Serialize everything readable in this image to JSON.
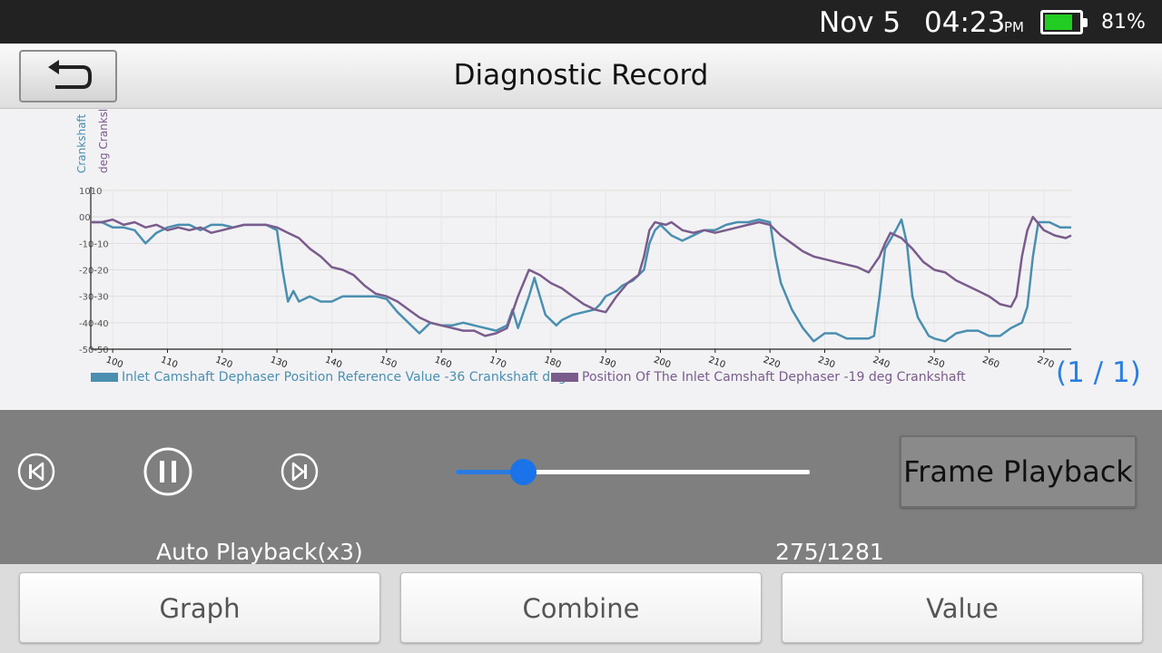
{
  "status": {
    "date": "Nov 5",
    "time": "04:23",
    "ampm": "PM",
    "battery_percent_text": "81%",
    "battery_level": 0.81,
    "battery_color": "#22cc22"
  },
  "header": {
    "title": "Diagnostic Record",
    "back_icon": "return-arrow-icon"
  },
  "chart_data": {
    "type": "line",
    "ylabels": [
      "Crankshaft",
      "deg Cranksl"
    ],
    "xticks": [
      100,
      110,
      120,
      130,
      140,
      150,
      160,
      170,
      180,
      190,
      200,
      210,
      220,
      230,
      240,
      250,
      260,
      270
    ],
    "yticks": [
      {
        "value": 10,
        "label": "1010"
      },
      {
        "value": 0,
        "label": "00"
      },
      {
        "value": -10,
        "label": "-10-10"
      },
      {
        "value": -20,
        "label": "-20-20"
      },
      {
        "value": -30,
        "label": "-30-30"
      },
      {
        "value": -40,
        "label": "-40-40"
      },
      {
        "value": -50,
        "label": "-50-50"
      }
    ],
    "xlim": [
      96,
      275
    ],
    "ylim": [
      -50,
      10
    ],
    "grid": true,
    "legend_position": "bottom",
    "series": [
      {
        "name": "Inlet Camshaft Dephaser Position Reference Value -36 Crankshaft deg",
        "color": "#4a8fb0",
        "points": [
          [
            96,
            -2
          ],
          [
            98,
            -2
          ],
          [
            100,
            -4
          ],
          [
            102,
            -4
          ],
          [
            104,
            -5
          ],
          [
            106,
            -10
          ],
          [
            108,
            -6
          ],
          [
            110,
            -4
          ],
          [
            112,
            -3
          ],
          [
            114,
            -3
          ],
          [
            116,
            -5
          ],
          [
            118,
            -3
          ],
          [
            120,
            -3
          ],
          [
            122,
            -4
          ],
          [
            124,
            -3
          ],
          [
            126,
            -3
          ],
          [
            128,
            -3
          ],
          [
            130,
            -5
          ],
          [
            131,
            -20
          ],
          [
            132,
            -32
          ],
          [
            133,
            -28
          ],
          [
            134,
            -32
          ],
          [
            136,
            -30
          ],
          [
            138,
            -32
          ],
          [
            140,
            -32
          ],
          [
            142,
            -30
          ],
          [
            144,
            -30
          ],
          [
            146,
            -30
          ],
          [
            148,
            -30
          ],
          [
            150,
            -31
          ],
          [
            152,
            -36
          ],
          [
            154,
            -40
          ],
          [
            156,
            -44
          ],
          [
            158,
            -40
          ],
          [
            160,
            -41
          ],
          [
            162,
            -41
          ],
          [
            164,
            -40
          ],
          [
            166,
            -41
          ],
          [
            168,
            -42
          ],
          [
            170,
            -43
          ],
          [
            172,
            -41
          ],
          [
            173,
            -35
          ],
          [
            174,
            -42
          ],
          [
            176,
            -30
          ],
          [
            177,
            -23
          ],
          [
            178,
            -30
          ],
          [
            179,
            -37
          ],
          [
            181,
            -41
          ],
          [
            182,
            -39
          ],
          [
            184,
            -37
          ],
          [
            186,
            -36
          ],
          [
            188,
            -35
          ],
          [
            189,
            -33
          ],
          [
            190,
            -30
          ],
          [
            192,
            -28
          ],
          [
            193,
            -26
          ],
          [
            195,
            -24
          ],
          [
            196,
            -22
          ],
          [
            197,
            -20
          ],
          [
            198,
            -10
          ],
          [
            199,
            -5
          ],
          [
            200,
            -3
          ],
          [
            202,
            -7
          ],
          [
            204,
            -9
          ],
          [
            206,
            -7
          ],
          [
            208,
            -5
          ],
          [
            210,
            -5
          ],
          [
            212,
            -3
          ],
          [
            214,
            -2
          ],
          [
            216,
            -2
          ],
          [
            218,
            -1
          ],
          [
            220,
            -2
          ],
          [
            221,
            -15
          ],
          [
            222,
            -25
          ],
          [
            224,
            -35
          ],
          [
            226,
            -42
          ],
          [
            228,
            -47
          ],
          [
            230,
            -44
          ],
          [
            232,
            -44
          ],
          [
            234,
            -46
          ],
          [
            236,
            -46
          ],
          [
            238,
            -46
          ],
          [
            239,
            -45
          ],
          [
            240,
            -30
          ],
          [
            241,
            -12
          ],
          [
            243,
            -5
          ],
          [
            244,
            -1
          ],
          [
            245,
            -10
          ],
          [
            246,
            -30
          ],
          [
            247,
            -38
          ],
          [
            249,
            -45
          ],
          [
            250,
            -46
          ],
          [
            252,
            -47
          ],
          [
            254,
            -44
          ],
          [
            256,
            -43
          ],
          [
            258,
            -43
          ],
          [
            260,
            -45
          ],
          [
            262,
            -45
          ],
          [
            264,
            -42
          ],
          [
            266,
            -40
          ],
          [
            267,
            -34
          ],
          [
            268,
            -15
          ],
          [
            269,
            -2
          ],
          [
            271,
            -2
          ],
          [
            273,
            -4
          ],
          [
            275,
            -4
          ]
        ]
      },
      {
        "name": "Position Of The Inlet Camshaft Dephaser -19 deg Crankshaft",
        "color": "#7a5c8c",
        "points": [
          [
            96,
            -2
          ],
          [
            98,
            -2
          ],
          [
            100,
            -1
          ],
          [
            102,
            -3
          ],
          [
            104,
            -2
          ],
          [
            106,
            -4
          ],
          [
            108,
            -3
          ],
          [
            110,
            -5
          ],
          [
            112,
            -4
          ],
          [
            114,
            -5
          ],
          [
            116,
            -4
          ],
          [
            118,
            -6
          ],
          [
            120,
            -5
          ],
          [
            122,
            -4
          ],
          [
            124,
            -3
          ],
          [
            126,
            -3
          ],
          [
            128,
            -3
          ],
          [
            130,
            -4
          ],
          [
            132,
            -6
          ],
          [
            134,
            -8
          ],
          [
            136,
            -12
          ],
          [
            138,
            -15
          ],
          [
            140,
            -19
          ],
          [
            142,
            -20
          ],
          [
            144,
            -22
          ],
          [
            146,
            -26
          ],
          [
            148,
            -29
          ],
          [
            150,
            -30
          ],
          [
            152,
            -32
          ],
          [
            154,
            -35
          ],
          [
            156,
            -38
          ],
          [
            158,
            -40
          ],
          [
            160,
            -41
          ],
          [
            162,
            -42
          ],
          [
            164,
            -43
          ],
          [
            166,
            -43
          ],
          [
            168,
            -45
          ],
          [
            170,
            -44
          ],
          [
            172,
            -42
          ],
          [
            174,
            -30
          ],
          [
            176,
            -20
          ],
          [
            178,
            -22
          ],
          [
            180,
            -25
          ],
          [
            182,
            -27
          ],
          [
            184,
            -30
          ],
          [
            186,
            -33
          ],
          [
            188,
            -35
          ],
          [
            190,
            -36
          ],
          [
            192,
            -30
          ],
          [
            194,
            -25
          ],
          [
            196,
            -22
          ],
          [
            197,
            -15
          ],
          [
            198,
            -5
          ],
          [
            199,
            -2
          ],
          [
            201,
            -3
          ],
          [
            202,
            -2
          ],
          [
            204,
            -5
          ],
          [
            206,
            -6
          ],
          [
            208,
            -5
          ],
          [
            210,
            -6
          ],
          [
            212,
            -5
          ],
          [
            214,
            -4
          ],
          [
            216,
            -3
          ],
          [
            218,
            -2
          ],
          [
            220,
            -3
          ],
          [
            222,
            -7
          ],
          [
            224,
            -10
          ],
          [
            226,
            -13
          ],
          [
            228,
            -15
          ],
          [
            230,
            -16
          ],
          [
            232,
            -17
          ],
          [
            234,
            -18
          ],
          [
            236,
            -19
          ],
          [
            238,
            -21
          ],
          [
            240,
            -15
          ],
          [
            241,
            -10
          ],
          [
            242,
            -6
          ],
          [
            244,
            -8
          ],
          [
            246,
            -12
          ],
          [
            248,
            -17
          ],
          [
            250,
            -20
          ],
          [
            252,
            -21
          ],
          [
            254,
            -24
          ],
          [
            256,
            -26
          ],
          [
            258,
            -28
          ],
          [
            260,
            -30
          ],
          [
            262,
            -33
          ],
          [
            264,
            -34
          ],
          [
            265,
            -30
          ],
          [
            266,
            -15
          ],
          [
            267,
            -5
          ],
          [
            268,
            0
          ],
          [
            270,
            -5
          ],
          [
            272,
            -7
          ],
          [
            274,
            -8
          ],
          [
            275,
            -7
          ]
        ]
      }
    ]
  },
  "pager": "(1 / 1)",
  "controls": {
    "prev_icon": "skip-previous-icon",
    "pause_icon": "pause-icon",
    "next_icon": "skip-next-icon",
    "slider_progress": 0.19,
    "slider_color": "#1a73e8",
    "frame_playback": "Frame Playback",
    "auto_playback": "Auto Playback(x3)",
    "frame_count": "275/1281"
  },
  "tabs": [
    "Graph",
    "Combine",
    "Value"
  ]
}
